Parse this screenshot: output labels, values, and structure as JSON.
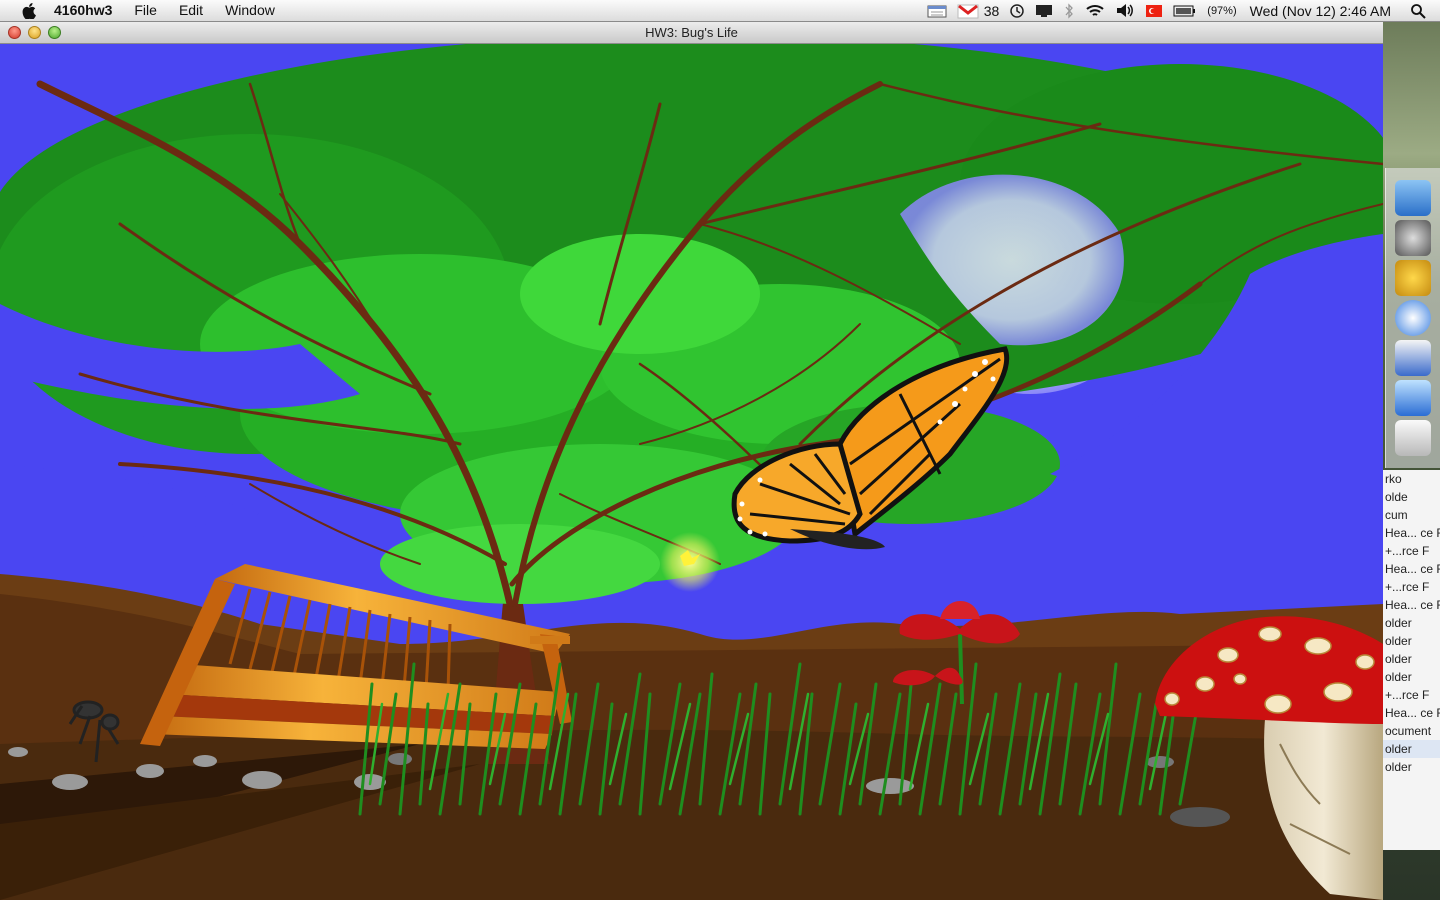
{
  "menubar": {
    "app_name": "4160hw3",
    "menus": [
      "File",
      "Edit",
      "Window"
    ],
    "mail_count": "38",
    "battery": "(97%)",
    "clock": "Wed (Nov 12)  2:46 AM"
  },
  "window": {
    "title": "HW3: Bug's Life"
  },
  "finder_list": [
    "rko",
    "olde",
    "cum",
    "Hea... ce F",
    "+...rce F",
    "Hea... ce F",
    "+...rce F",
    "Hea... ce F",
    "older",
    "older",
    "older",
    "older",
    "+...rce F",
    "Hea... ce F",
    "ocument",
    "older",
    "older"
  ],
  "colors": {
    "sky": "#4a46f2",
    "ground": "#4a2a0e",
    "hills": "#6b3d14",
    "leaf_dark": "#1c8c1c",
    "leaf_light": "#3fd83a",
    "branch": "#6b2a12",
    "mushroom_cap": "#cc1010",
    "flower": "#c8141a",
    "butterfly": "#f59a1a"
  }
}
